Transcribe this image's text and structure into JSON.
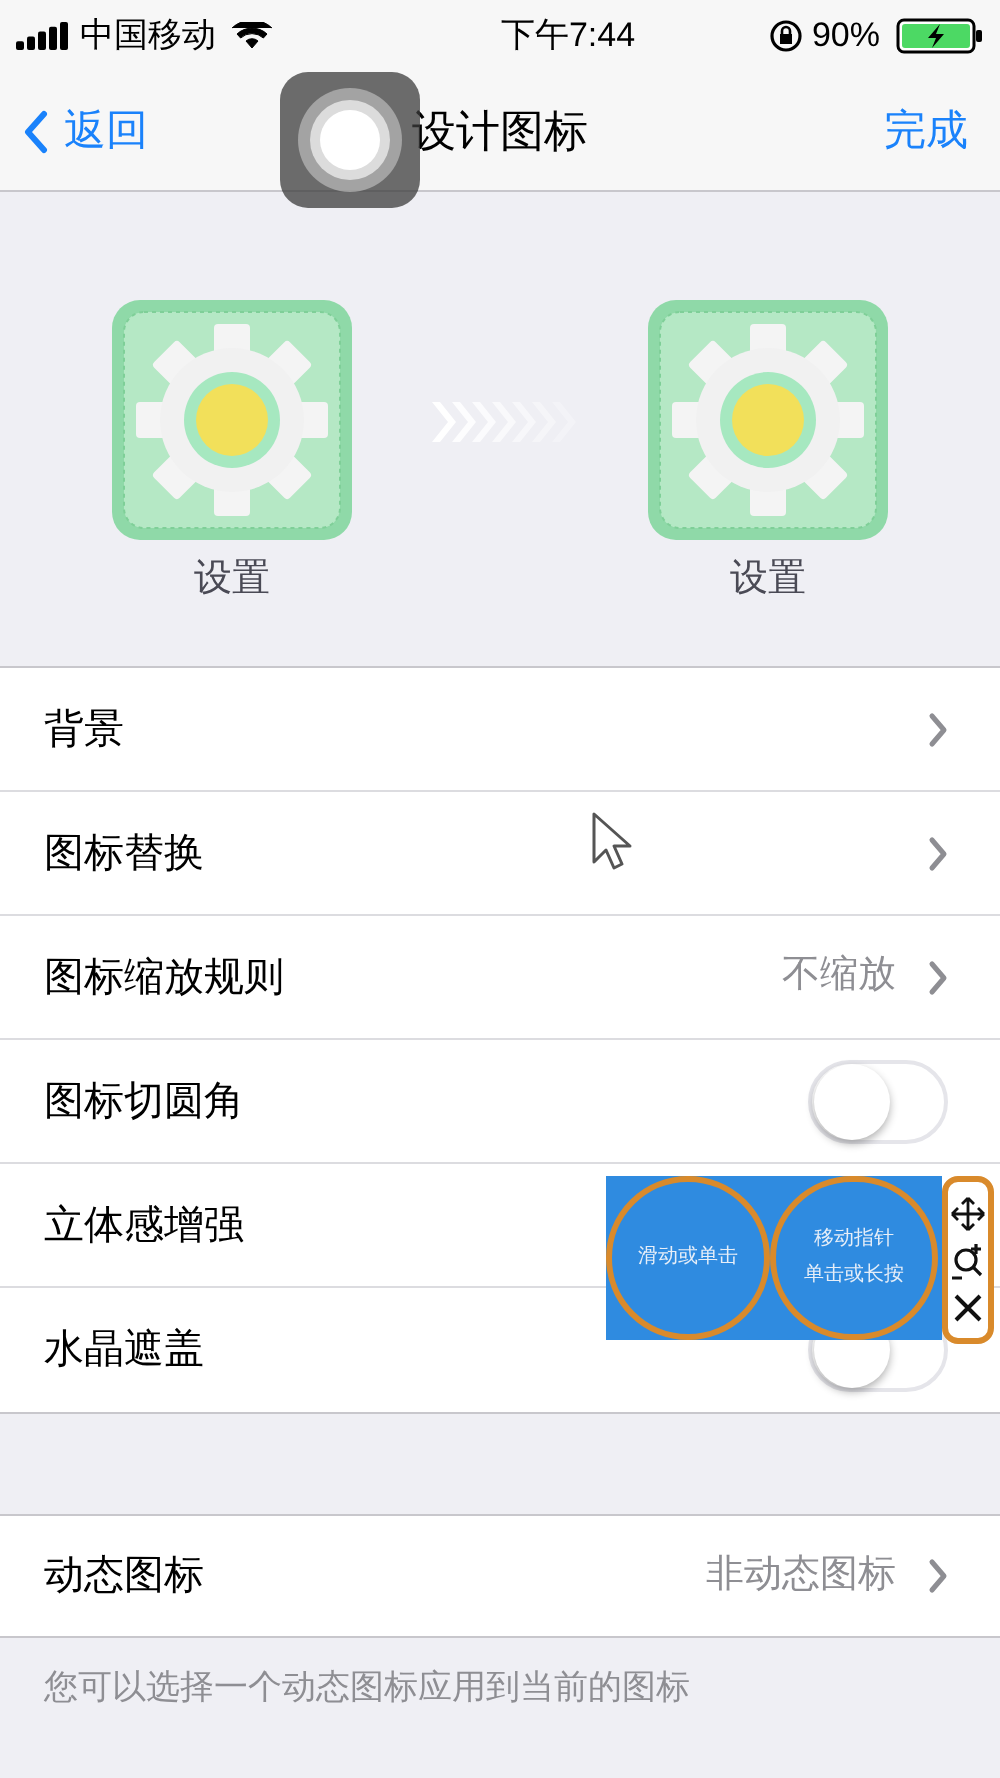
{
  "status_bar": {
    "carrier": "中国移动",
    "time": "下午7:44",
    "battery": "90%"
  },
  "nav": {
    "back": "返回",
    "title": "设计图标",
    "done": "完成"
  },
  "preview": {
    "before_label": "设置",
    "after_label": "设置"
  },
  "settings": [
    {
      "kind": "link",
      "label": "背景"
    },
    {
      "kind": "link",
      "label": "图标替换"
    },
    {
      "kind": "link",
      "label": "图标缩放规则",
      "value": "不缩放"
    },
    {
      "kind": "switch",
      "label": "图标切圆角",
      "on": false
    },
    {
      "kind": "plain",
      "label": "立体感增强"
    },
    {
      "kind": "switch",
      "label": "水晶遮盖",
      "on": false
    }
  ],
  "dynamic": {
    "label": "动态图标",
    "value": "非动态图标"
  },
  "footer": "您可以选择一个动态图标应用到当前的图标",
  "floating_toolbar": {
    "left": "滑动或单击",
    "right_line_1": "移动指针",
    "right_line_2": "单击或长按"
  }
}
